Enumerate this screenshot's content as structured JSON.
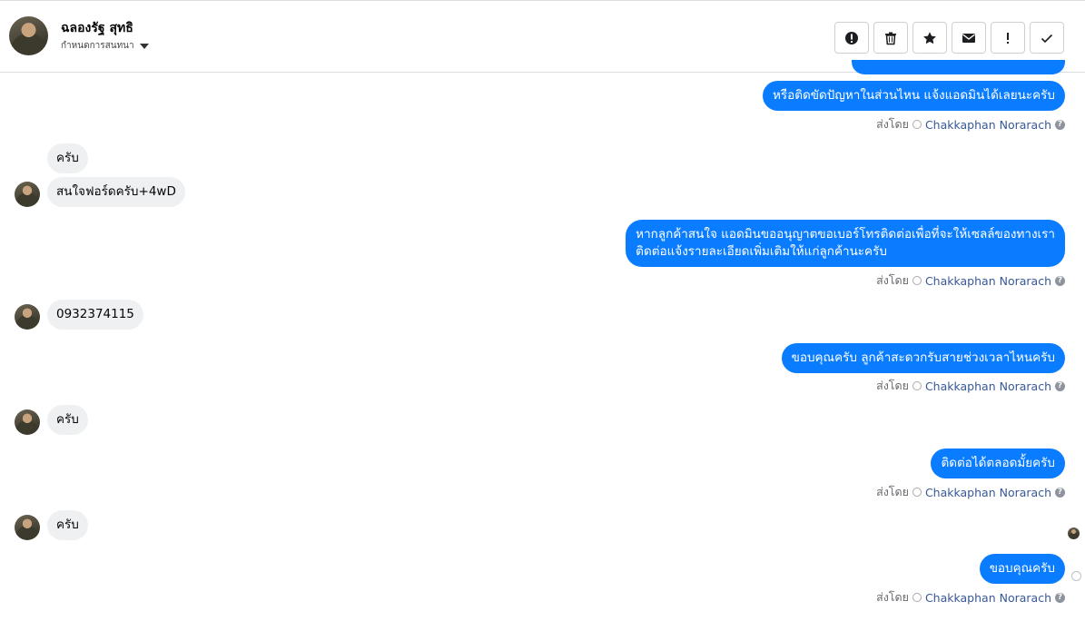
{
  "header": {
    "contact_name": "ฉลองรัฐ สุทธิ",
    "conversation_label": "กำหนดการสนทนา",
    "toolbar": [
      {
        "name": "report-button",
        "icon": "alert-circle-icon"
      },
      {
        "name": "delete-button",
        "icon": "trash-icon"
      },
      {
        "name": "star-button",
        "icon": "star-icon"
      },
      {
        "name": "mark-unread-button",
        "icon": "envelope-icon"
      },
      {
        "name": "mark-spam-button",
        "icon": "exclamation-icon"
      },
      {
        "name": "mark-done-button",
        "icon": "check-icon"
      }
    ]
  },
  "sent_by_prefix": "ส่งโดย",
  "sender": "Chakkaphan Norarach",
  "messages": [
    {
      "dir": "out",
      "text": "หรือติดขัดปัญหาในส่วนไหน แจ้งแอดมินได้เลยนะครับ"
    },
    {
      "dir": "in",
      "text": "ครับ"
    },
    {
      "dir": "in",
      "text": "สนใจฟอร์ดครับ+4wD"
    },
    {
      "dir": "out",
      "lines": [
        "หากลูกค้าสนใจ แอดมินขออนุญาตขอเบอร์โทรติดต่อเพื่อที่จะให้เซลล์ของทางเรา",
        "ติดต่อแจ้งรายละเอียดเพิ่มเติมให้แก่ลูกค้านะครับ"
      ]
    },
    {
      "dir": "in",
      "text": "0932374115"
    },
    {
      "dir": "out",
      "text": "ขอบคุณครับ ลูกค้าสะดวกรับสายช่วงเวลาไหนครับ"
    },
    {
      "dir": "in",
      "text": "ครับ"
    },
    {
      "dir": "out",
      "text": "ติดต่อได้ตลอดมั้ยครับ"
    },
    {
      "dir": "in",
      "text": "ครับ"
    },
    {
      "dir": "out",
      "text": "ขอบคุณครับ"
    }
  ],
  "colors": {
    "outgoing_bubble": "#0a7cff",
    "incoming_bubble": "#eef0f2",
    "sender_link": "#385898"
  }
}
